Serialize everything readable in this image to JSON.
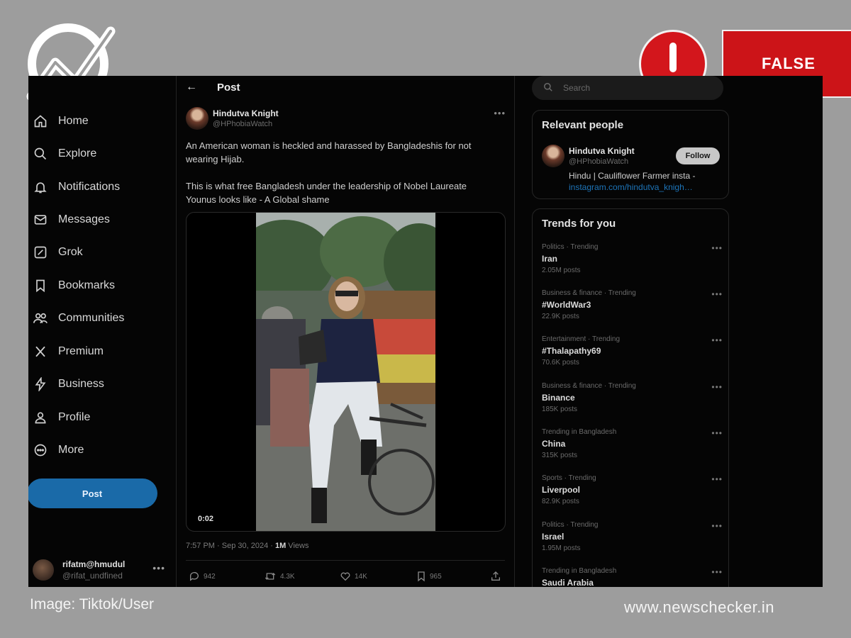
{
  "nav": {
    "items": [
      {
        "label": "Home",
        "icon": "home-icon"
      },
      {
        "label": "Explore",
        "icon": "search-icon"
      },
      {
        "label": "Notifications",
        "icon": "bell-icon"
      },
      {
        "label": "Messages",
        "icon": "mail-icon"
      },
      {
        "label": "Grok",
        "icon": "grok-icon"
      },
      {
        "label": "Bookmarks",
        "icon": "bookmark-icon"
      },
      {
        "label": "Communities",
        "icon": "communities-icon"
      },
      {
        "label": "Premium",
        "icon": "x-logo-icon"
      },
      {
        "label": "Business",
        "icon": "lightning-icon"
      },
      {
        "label": "Profile",
        "icon": "person-icon"
      },
      {
        "label": "More",
        "icon": "more-circle-icon"
      }
    ],
    "post_button": "Post"
  },
  "account": {
    "name": "rifatm@hmudul",
    "handle": "@rifat_undfined"
  },
  "post": {
    "header_title": "Post",
    "author_name": "Hindutva Knight",
    "author_handle": "@HPhobiaWatch",
    "text_line1": "An American woman is heckled and harassed by Bangladeshis for not",
    "text_line2": "wearing Hijab.",
    "text_line3": "This is what free Bangladesh under the leadership of Nobel Laureate",
    "text_line4": "Younus looks like - A Global shame",
    "video_time": "0:02",
    "timestamp": "7:57 PM · Sep 30, 2024 · ",
    "views_count": "1M",
    "views_label": " Views",
    "actions": {
      "replies": "942",
      "reposts": "4.3K",
      "likes": "14K",
      "bookmarks": "965"
    }
  },
  "search": {
    "placeholder": "Search"
  },
  "relevant_people": {
    "title": "Relevant people",
    "name": "Hindutva Knight",
    "handle": "@HPhobiaWatch",
    "follow_label": "Follow",
    "bio": "Hindu | Cauliflower Farmer insta -",
    "link": "instagram.com/hindutva_knigh…"
  },
  "trends": {
    "title": "Trends for you",
    "items": [
      {
        "context": "Politics · Trending",
        "name": "Iran",
        "count": "2.05M posts"
      },
      {
        "context": "Business & finance · Trending",
        "name": "#WorldWar3",
        "count": "22.9K posts"
      },
      {
        "context": "Entertainment · Trending",
        "name": "#Thalapathy69",
        "count": "70.6K posts"
      },
      {
        "context": "Business & finance · Trending",
        "name": "Binance",
        "count": "185K posts"
      },
      {
        "context": "Trending in Bangladesh",
        "name": "China",
        "count": "315K posts"
      },
      {
        "context": "Sports · Trending",
        "name": "Liverpool",
        "count": "82.9K posts"
      },
      {
        "context": "Politics · Trending",
        "name": "Israel",
        "count": "1.95M posts"
      },
      {
        "context": "Trending in Bangladesh",
        "name": "Saudi Arabia",
        "count": ""
      }
    ]
  },
  "overlay": {
    "verdict": "FALSE",
    "image_credit": "Image: Tiktok/User",
    "site": "www.newschecker.in",
    "verdict_color": "#cc1418"
  }
}
